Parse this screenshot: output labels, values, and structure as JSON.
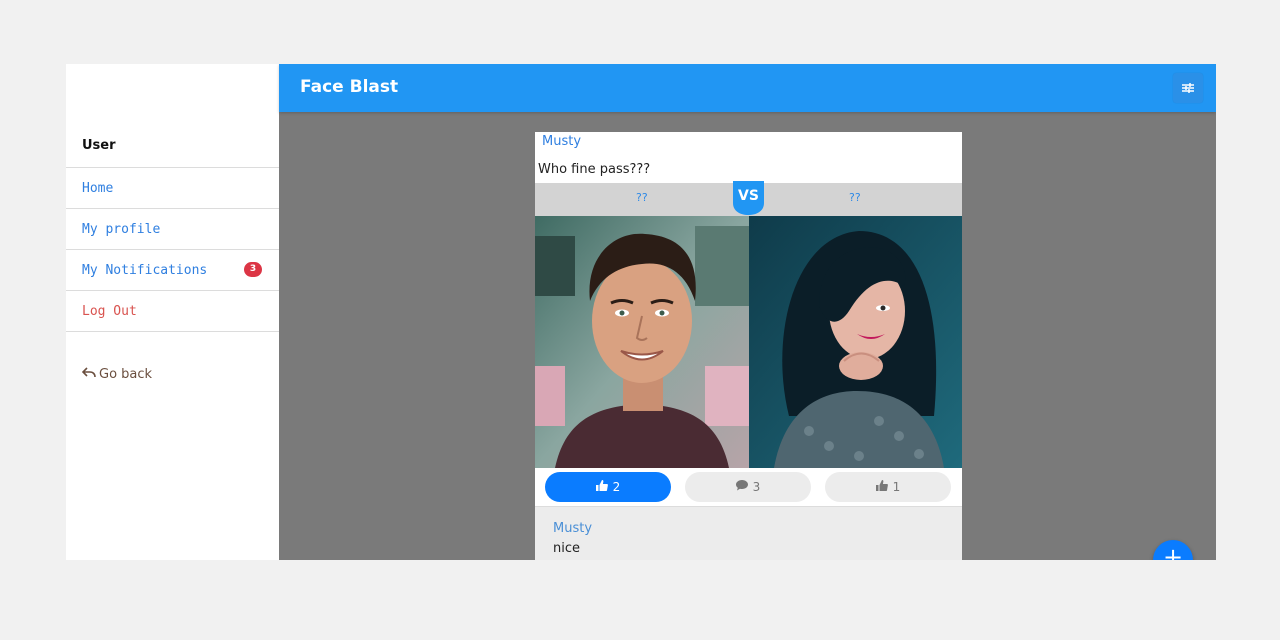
{
  "app": {
    "title": "Face Blast"
  },
  "sidebar": {
    "heading": "User",
    "items": [
      {
        "label": "Home"
      },
      {
        "label": "My profile"
      },
      {
        "label": "My Notifications",
        "badge": "3"
      },
      {
        "label": "Log Out"
      }
    ],
    "go_back": "Go back"
  },
  "post": {
    "author": "Musty",
    "question": "Who fine pass???",
    "vs_label": "VS",
    "left_name": "??",
    "right_name": "??",
    "actions": {
      "like_count": "2",
      "comment_count": "3",
      "other_like_count": "1"
    },
    "comment": {
      "author": "Musty",
      "text": "nice"
    }
  },
  "colors": {
    "primary": "#2196f3",
    "accent": "#0a7cff",
    "danger": "#dc3545",
    "link": "#2f7fe0"
  },
  "icons": {
    "filter": "sliders-icon",
    "back": "undo-arrow-icon",
    "like": "thumbs-up-icon",
    "comment": "comment-icon",
    "fab": "plus-icon"
  }
}
